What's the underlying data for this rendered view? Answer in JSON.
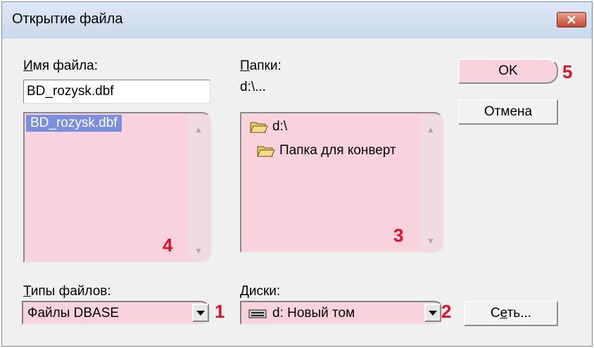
{
  "window": {
    "title": "Открытие файла"
  },
  "filename": {
    "label": "Имя файла:",
    "label_underline": "И",
    "label_rest": "мя файла:",
    "value": "BD_rozysk.dbf"
  },
  "file_list": {
    "items": [
      "BD_rozysk.dbf"
    ],
    "selected_index": 0,
    "annotation": "4"
  },
  "folders": {
    "label_underline": "П",
    "label_rest": "апки:",
    "current_path": "d:\\...",
    "items": [
      {
        "name": "d:\\",
        "icon": "open-folder-icon"
      },
      {
        "name": "Папка для конверт",
        "icon": "open-folder-icon"
      }
    ],
    "annotation": "3"
  },
  "buttons": {
    "ok_label": "OK",
    "ok_annotation": "5",
    "cancel_label": "Отмена",
    "network_prefix": "С",
    "network_underline": "е",
    "network_rest": "ть..."
  },
  "file_types": {
    "label_underline": "Т",
    "label_rest": "ипы файлов:",
    "selected": "Файлы DBASE",
    "annotation": "1"
  },
  "drives": {
    "label_underline": "Д",
    "label_rest": "иски:",
    "selected": "d: Новый том",
    "icon": "drive-icon",
    "annotation": "2"
  },
  "colors": {
    "highlight": "#f8d2dc",
    "annotation": "#e0102a",
    "selection": "#7c8ee0"
  }
}
